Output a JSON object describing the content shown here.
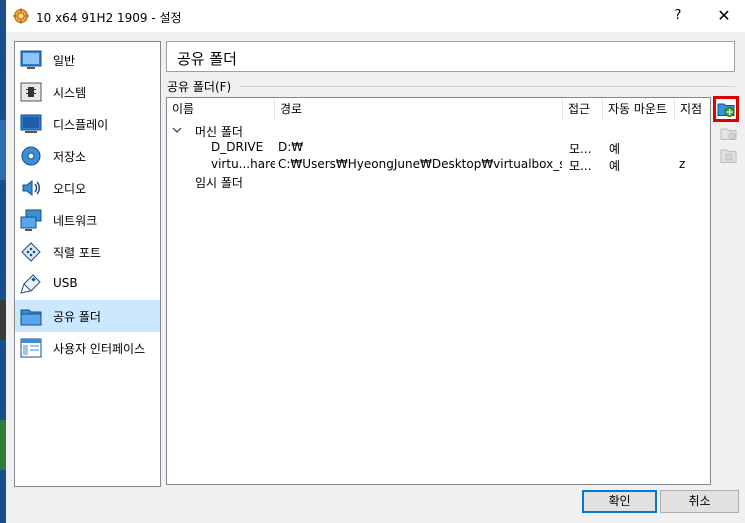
{
  "window": {
    "title": "10 x64 91H2 1909 - 설정",
    "help_label": "?",
    "close_label": "✕"
  },
  "nav": {
    "items": [
      {
        "label": "일반",
        "icon": "general-icon"
      },
      {
        "label": "시스템",
        "icon": "system-icon"
      },
      {
        "label": "디스플레이",
        "icon": "display-icon"
      },
      {
        "label": "저장소",
        "icon": "storage-icon"
      },
      {
        "label": "오디오",
        "icon": "audio-icon"
      },
      {
        "label": "네트워크",
        "icon": "network-icon"
      },
      {
        "label": "직렬 포트",
        "icon": "serial-port-icon"
      },
      {
        "label": "USB",
        "icon": "usb-icon"
      },
      {
        "label": "공유 폴더",
        "icon": "shared-folder-icon",
        "selected": true
      },
      {
        "label": "사용자 인터페이스",
        "icon": "user-interface-icon"
      }
    ]
  },
  "page": {
    "title": "공유 폴더",
    "section_label": "공유 폴더(F)"
  },
  "table": {
    "columns": [
      "이름",
      "경로",
      "접근",
      "자동 마운트",
      "지점"
    ],
    "groups": [
      {
        "label": "머신 폴더",
        "rows": [
          {
            "name": "D_DRIVE",
            "path": "D:₩",
            "access": "모...",
            "automount": "예",
            "mountpoint": ""
          },
          {
            "name": "virtu...hare",
            "path": "C:₩Users₩HyeongJune₩Desktop₩virtualbox_share",
            "access": "모...",
            "automount": "예",
            "mountpoint": "z"
          }
        ]
      },
      {
        "label": "임시 폴더",
        "rows": []
      }
    ]
  },
  "tools": {
    "add_icon": "add-shared-folder-icon",
    "edit_icon": "edit-shared-folder-icon",
    "remove_icon": "remove-shared-folder-icon"
  },
  "buttons": {
    "ok": "확인",
    "cancel": "취소"
  },
  "colors": {
    "selection": "#cce8ff",
    "highlight_border": "#e00000",
    "default_button_border": "#0078d7"
  }
}
